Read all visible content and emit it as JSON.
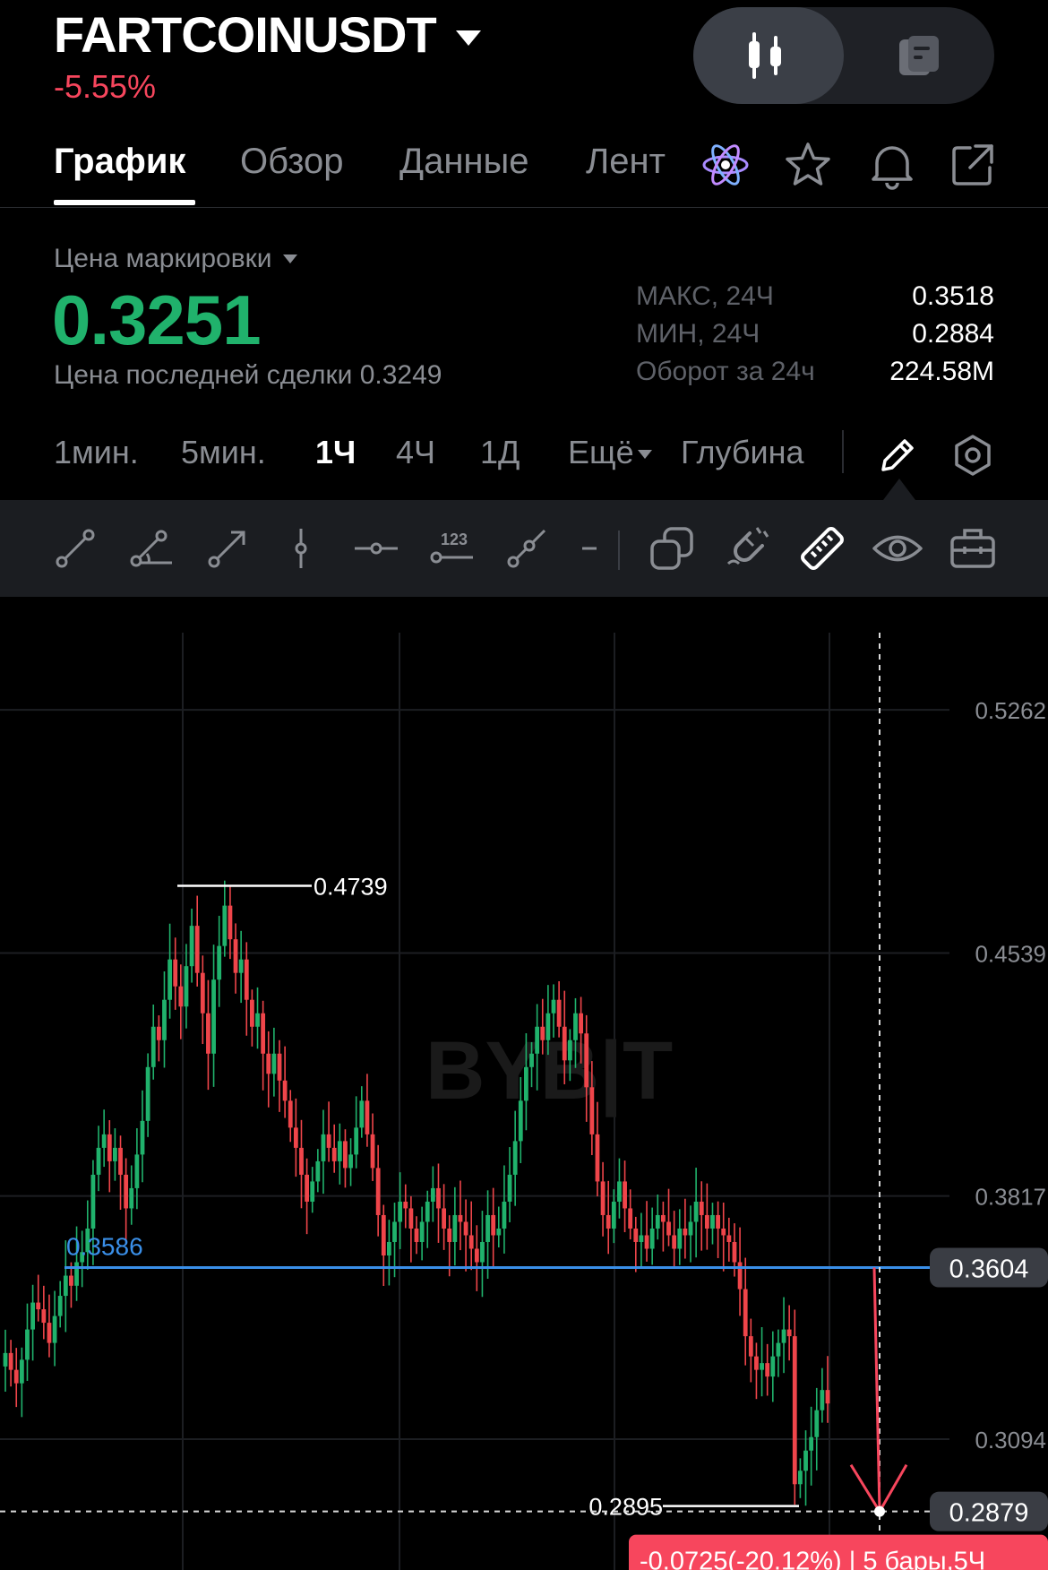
{
  "header": {
    "symbol": "FARTCOINUSDT",
    "change": "-5.55%",
    "toggle": {
      "chart_icon": "candlestick-icon",
      "info_icon": "document-icon",
      "active": "chart"
    }
  },
  "tabs": {
    "items": [
      {
        "label": "График",
        "active": true
      },
      {
        "label": "Обзор",
        "active": false
      },
      {
        "label": "Данные",
        "active": false
      },
      {
        "label": "Лент",
        "active": false
      }
    ],
    "icons": [
      "atom-icon",
      "star-icon",
      "bell-icon",
      "share-icon"
    ]
  },
  "price": {
    "mark_label": "Цена маркировки",
    "mark_price": "0.3251",
    "last_price": "Цена последней сделки 0.3249",
    "stats": [
      {
        "label": "МАКС, 24Ч",
        "value": "0.3518"
      },
      {
        "label": "МИН, 24Ч",
        "value": "0.2884"
      },
      {
        "label": "Оборот за 24ч",
        "value": "224.58M"
      }
    ]
  },
  "intervals": {
    "items": [
      {
        "label": "1мин.",
        "active": false
      },
      {
        "label": "5мин.",
        "active": false
      },
      {
        "label": "1Ч",
        "active": true
      },
      {
        "label": "4Ч",
        "active": false
      },
      {
        "label": "1Д",
        "active": false
      },
      {
        "label": "Ещё",
        "active": false
      },
      {
        "label": "Глубина",
        "active": false
      }
    ],
    "icons": [
      "pencil-icon",
      "settings-icon"
    ]
  },
  "drawing_tools": [
    "trend-line-icon",
    "angle-line-icon",
    "arrow-line-icon",
    "vertical-line-icon",
    "horizontal-line-icon",
    "price-label-icon",
    "ray-line-icon",
    "more-line-icon",
    "layers-icon",
    "magnet-icon",
    "ruler-icon",
    "eye-icon",
    "toolbox-icon"
  ],
  "chart_data": {
    "type": "candlestick",
    "y_axis_labels": [
      "0.5262",
      "0.4539",
      "0.3817",
      "0.3094"
    ],
    "ylim": [
      0.2705,
      0.5598
    ],
    "annotations": {
      "high_label": "0.4739",
      "low_label": "0.2895",
      "horizontal_line_label": "0.3586",
      "horizontal_line_price_tag": "0.3604",
      "crosshair_price_tag": "0.2879",
      "measurement": "-0.0725(-20.12%) | 5 бары,5Ч"
    },
    "closes": [
      0.335,
      0.33,
      0.326,
      0.333,
      0.342,
      0.35,
      0.348,
      0.344,
      0.338,
      0.346,
      0.352,
      0.358,
      0.355,
      0.362,
      0.365,
      0.372,
      0.388,
      0.396,
      0.4,
      0.392,
      0.396,
      0.388,
      0.378,
      0.384,
      0.394,
      0.404,
      0.42,
      0.432,
      0.428,
      0.44,
      0.452,
      0.444,
      0.438,
      0.45,
      0.462,
      0.448,
      0.436,
      0.424,
      0.446,
      0.456,
      0.468,
      0.458,
      0.448,
      0.452,
      0.44,
      0.432,
      0.436,
      0.424,
      0.418,
      0.424,
      0.416,
      0.41,
      0.402,
      0.396,
      0.388,
      0.38,
      0.386,
      0.392,
      0.4,
      0.396,
      0.392,
      0.398,
      0.39,
      0.394,
      0.402,
      0.41,
      0.4,
      0.39,
      0.376,
      0.364,
      0.368,
      0.374,
      0.38,
      0.378,
      0.372,
      0.368,
      0.374,
      0.38,
      0.384,
      0.378,
      0.372,
      0.368,
      0.376,
      0.374,
      0.37,
      0.366,
      0.362,
      0.368,
      0.376,
      0.37,
      0.372,
      0.38,
      0.388,
      0.398,
      0.41,
      0.42,
      0.424,
      0.432,
      0.428,
      0.436,
      0.44,
      0.432,
      0.422,
      0.428,
      0.436,
      0.43,
      0.414,
      0.4,
      0.386,
      0.376,
      0.372,
      0.38,
      0.386,
      0.378,
      0.372,
      0.368,
      0.37,
      0.366,
      0.372,
      0.376,
      0.374,
      0.37,
      0.366,
      0.372,
      0.37,
      0.374,
      0.38,
      0.376,
      0.372,
      0.376,
      0.372,
      0.37,
      0.368,
      0.362,
      0.354,
      0.34,
      0.334,
      0.33,
      0.332,
      0.328,
      0.334,
      0.338,
      0.342,
      0.34,
      0.296,
      0.3,
      0.306,
      0.31,
      0.318,
      0.324,
      0.32
    ]
  }
}
